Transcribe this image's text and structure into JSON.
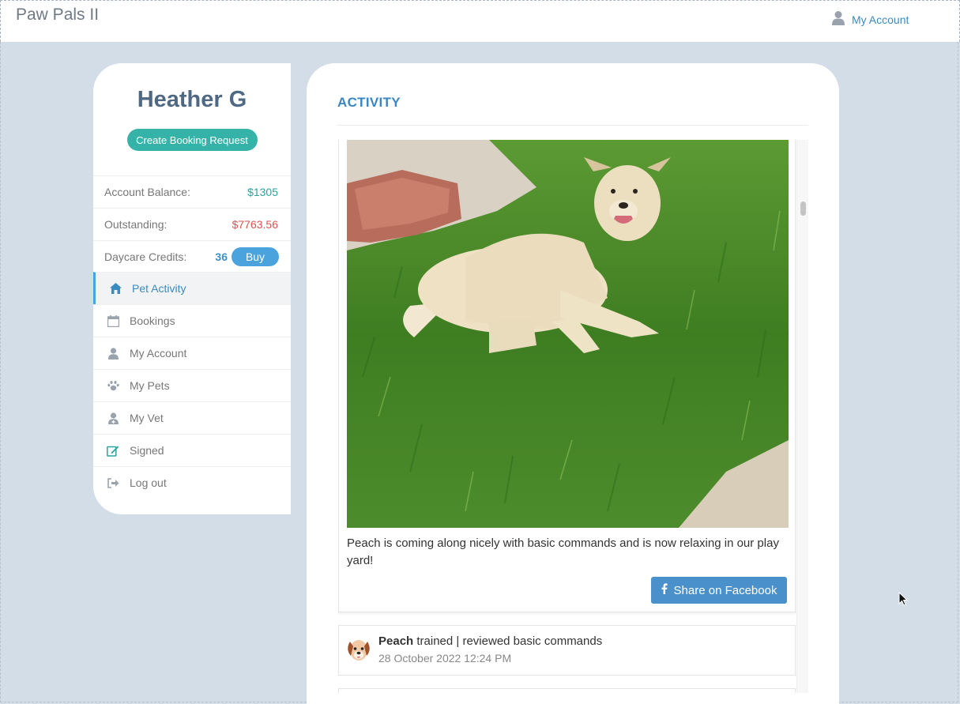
{
  "app": {
    "title": "Paw Pals II"
  },
  "header": {
    "account_link": "My Account",
    "account_icon": "user-icon"
  },
  "sidebar": {
    "user_name": "Heather G",
    "booking_button": "Create Booking Request",
    "balance": {
      "label": "Account Balance:",
      "value": "$1305"
    },
    "outstanding": {
      "label": "Outstanding:",
      "value": "$7763.56"
    },
    "credits": {
      "label": "Daycare Credits:",
      "value": "36",
      "buy_label": "Buy"
    },
    "items": [
      {
        "label": "Pet Activity",
        "icon": "home-icon",
        "active": true
      },
      {
        "label": "Bookings",
        "icon": "calendar-icon"
      },
      {
        "label": "My Account",
        "icon": "user-icon"
      },
      {
        "label": "My Pets",
        "icon": "paw-icon"
      },
      {
        "label": "My Vet",
        "icon": "doctor-icon"
      },
      {
        "label": "Signed",
        "icon": "edit-icon"
      },
      {
        "label": "Log out",
        "icon": "sign-out-icon"
      }
    ]
  },
  "main": {
    "title": "ACTIVITY",
    "post": {
      "caption": "Peach is coming along nicely with basic commands and is now relaxing in our play yard!",
      "share_label": "Share on Facebook"
    },
    "activity": {
      "pet": "Peach",
      "text": "trained | reviewed basic commands",
      "date": "28 October 2022 12:24 PM"
    }
  },
  "colors": {
    "accent": "#3a86c2",
    "teal": "#36b3a8",
    "red": "#d9534f",
    "background": "#d3dde8"
  }
}
